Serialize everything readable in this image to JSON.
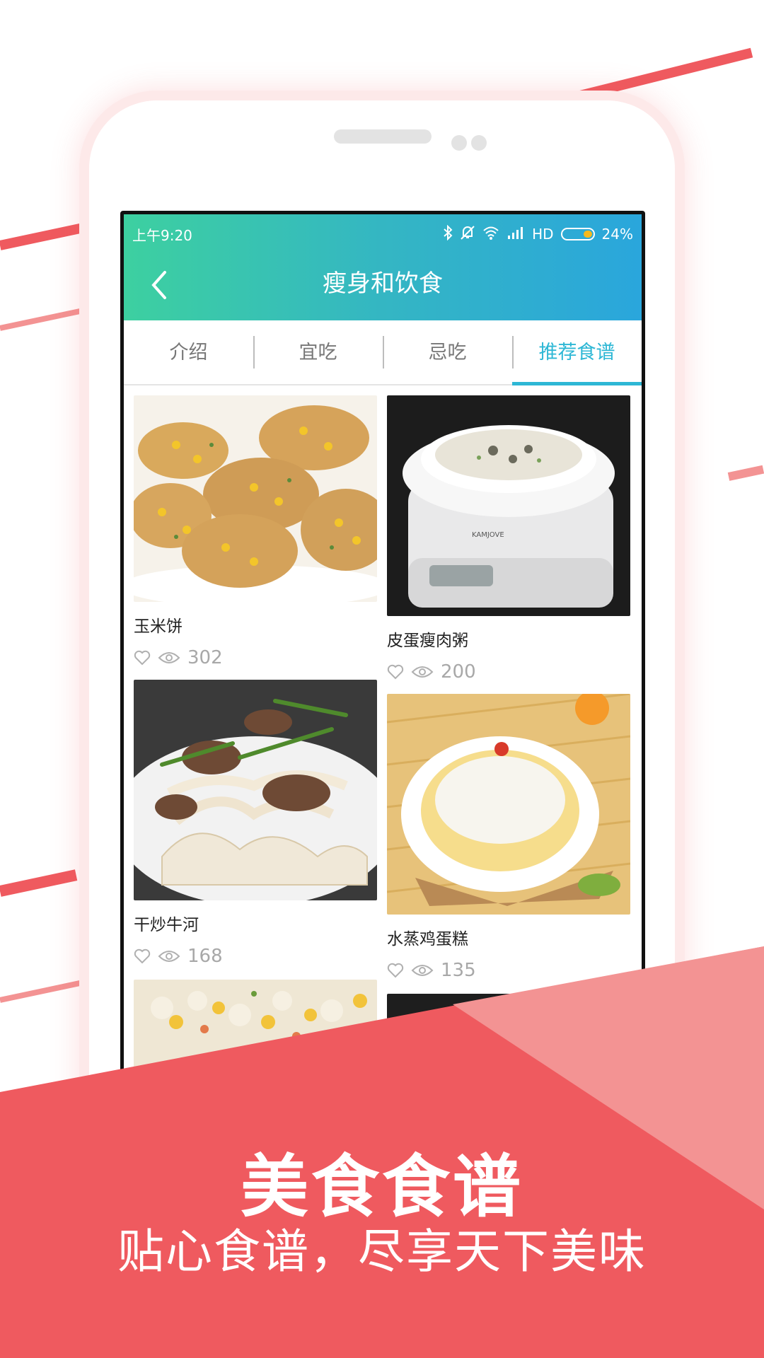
{
  "colors": {
    "accent_red": "#ef5a5f",
    "accent_red_light": "#f39393",
    "appbar_gradient_start": "#3dd0a0",
    "appbar_gradient_end": "#2aa6dc",
    "tab_active": "#2db7d5"
  },
  "status_bar": {
    "time": "上午9:20",
    "network": "HD",
    "battery": "24%",
    "icons": [
      "bluetooth-icon",
      "mute-icon",
      "wifi-icon",
      "signal-icon",
      "battery-icon"
    ]
  },
  "header": {
    "title": "瘦身和饮食",
    "back_icon": "chevron-left-icon"
  },
  "tabs": [
    {
      "label": "介绍"
    },
    {
      "label": "宜吃"
    },
    {
      "label": "忌吃"
    },
    {
      "label": "推荐食谱",
      "active": true
    }
  ],
  "recipes": [
    {
      "name": "玉米饼",
      "views": "302"
    },
    {
      "name": "皮蛋瘦肉粥",
      "views": "200"
    },
    {
      "name": "干炒牛河",
      "views": "168"
    },
    {
      "name": "水蒸鸡蛋糕",
      "views": "135"
    }
  ],
  "banner": {
    "headline": "美食食谱",
    "subline": "贴心食谱，尽享天下美味"
  }
}
